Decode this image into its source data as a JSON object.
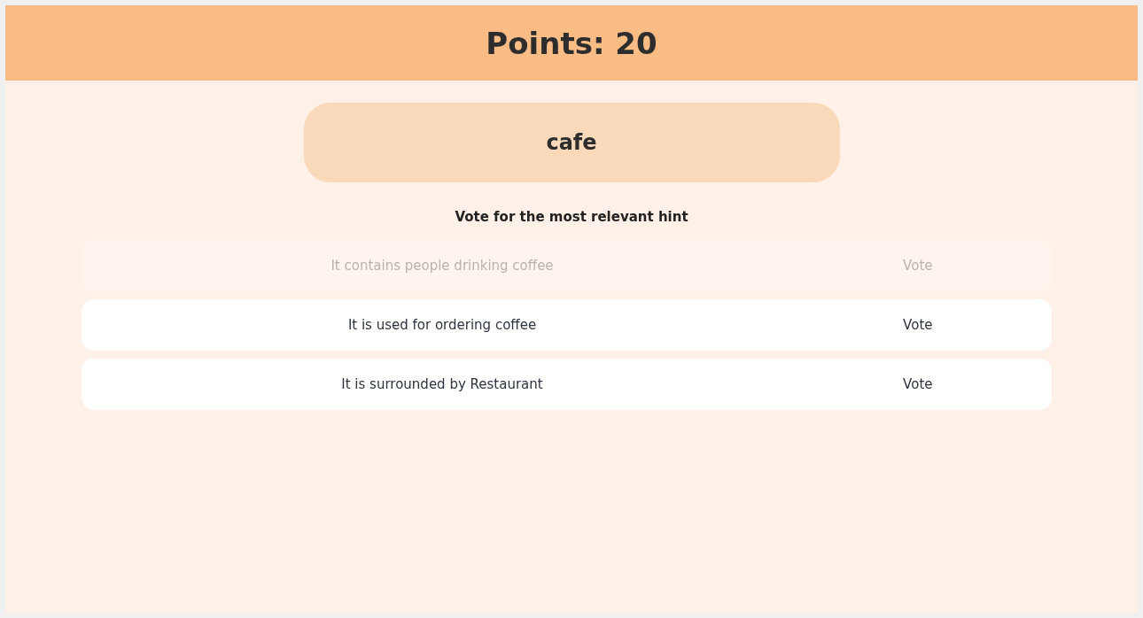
{
  "header": {
    "title": "Points: 20"
  },
  "word_card": {
    "word": "cafe"
  },
  "instruction": "Vote for the most relevant hint",
  "hints": [
    {
      "text": "It contains people drinking coffee",
      "button": "Vote",
      "disabled": true
    },
    {
      "text": "It is used for ordering coffee",
      "button": "Vote",
      "disabled": false
    },
    {
      "text": "It is surrounded by Restaurant",
      "button": "Vote",
      "disabled": false
    }
  ]
}
